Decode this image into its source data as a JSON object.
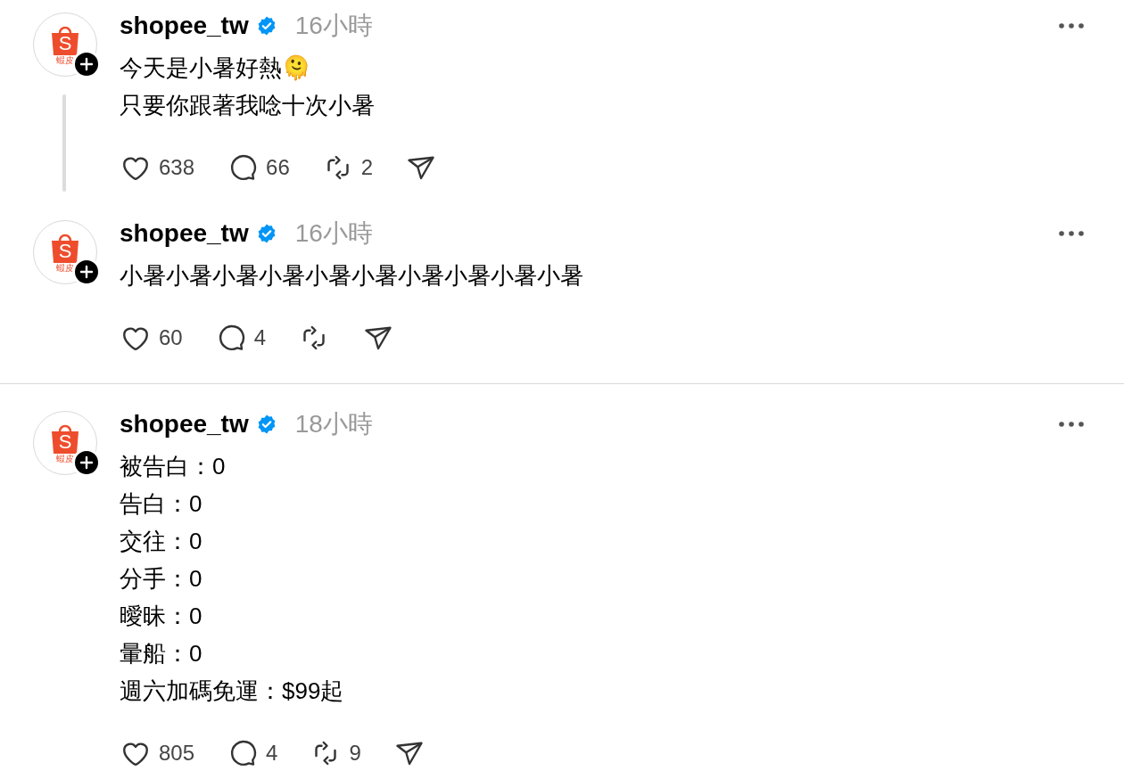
{
  "threads": [
    {
      "posts": [
        {
          "avatar": {
            "logo_letter": "S",
            "logo_caption": "蝦皮"
          },
          "username": "shopee_tw",
          "verified": true,
          "time": "16小時",
          "body": [
            "今天是小暑好熱🫠",
            "只要你跟著我唸十次小暑"
          ],
          "actions": [
            {
              "kind": "like",
              "count": "638"
            },
            {
              "kind": "reply",
              "count": "66"
            },
            {
              "kind": "repost",
              "count": "2"
            },
            {
              "kind": "share"
            }
          ]
        },
        {
          "avatar": {
            "logo_letter": "S",
            "logo_caption": "蝦皮"
          },
          "username": "shopee_tw",
          "verified": true,
          "time": "16小時",
          "body": [
            "小暑小暑小暑小暑小暑小暑小暑小暑小暑小暑"
          ],
          "actions": [
            {
              "kind": "like",
              "count": "60"
            },
            {
              "kind": "reply",
              "count": "4"
            },
            {
              "kind": "repost"
            },
            {
              "kind": "share"
            }
          ]
        }
      ]
    },
    {
      "posts": [
        {
          "avatar": {
            "logo_letter": "S",
            "logo_caption": "蝦皮"
          },
          "username": "shopee_tw",
          "verified": true,
          "time": "18小時",
          "body": [
            "被告白：0",
            "告白：0",
            "交往：0",
            "分手：0",
            "曖昧：0",
            "暈船：0",
            "週六加碼免運：$99起"
          ],
          "actions": [
            {
              "kind": "like",
              "count": "805"
            },
            {
              "kind": "reply",
              "count": "4"
            },
            {
              "kind": "repost",
              "count": "9"
            },
            {
              "kind": "share"
            }
          ]
        }
      ]
    }
  ]
}
